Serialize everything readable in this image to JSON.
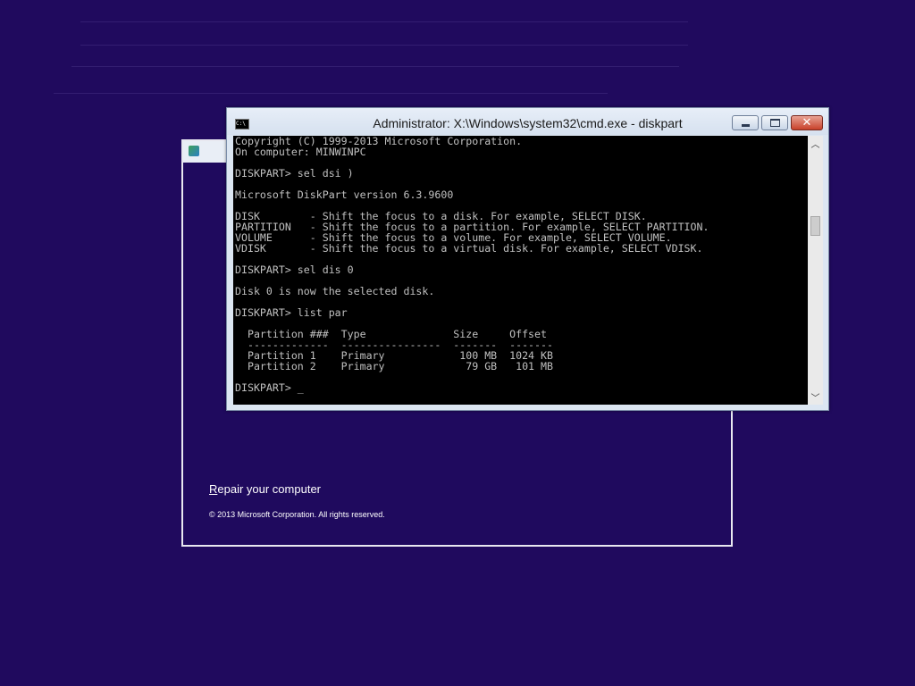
{
  "cmd": {
    "title": "Administrator: X:\\Windows\\system32\\cmd.exe - diskpart",
    "icon_text": "C:\\",
    "console_lines": [
      "Copyright (C) 1999-2013 Microsoft Corporation.",
      "On computer: MINWINPC",
      "",
      "DISKPART> sel dsi )",
      "",
      "Microsoft DiskPart version 6.3.9600",
      "",
      "DISK        - Shift the focus to a disk. For example, SELECT DISK.",
      "PARTITION   - Shift the focus to a partition. For example, SELECT PARTITION.",
      "VOLUME      - Shift the focus to a volume. For example, SELECT VOLUME.",
      "VDISK       - Shift the focus to a virtual disk. For example, SELECT VDISK.",
      "",
      "DISKPART> sel dis 0",
      "",
      "Disk 0 is now the selected disk.",
      "",
      "DISKPART> list par",
      "",
      "  Partition ###  Type              Size     Offset",
      "  -------------  ----------------  -------  -------",
      "  Partition 1    Primary            100 MB  1024 KB",
      "  Partition 2    Primary             79 GB   101 MB",
      "",
      "DISKPART> _"
    ],
    "colors": {
      "console_bg": "#000000",
      "console_fg": "#c0c0c0",
      "close_button": "#c8412a"
    }
  },
  "setup": {
    "repair_link_underlined": "R",
    "repair_link_rest": "epair your computer",
    "copyright": "© 2013 Microsoft Corporation. All rights reserved."
  },
  "desktop": {
    "background": "#200a5e"
  }
}
